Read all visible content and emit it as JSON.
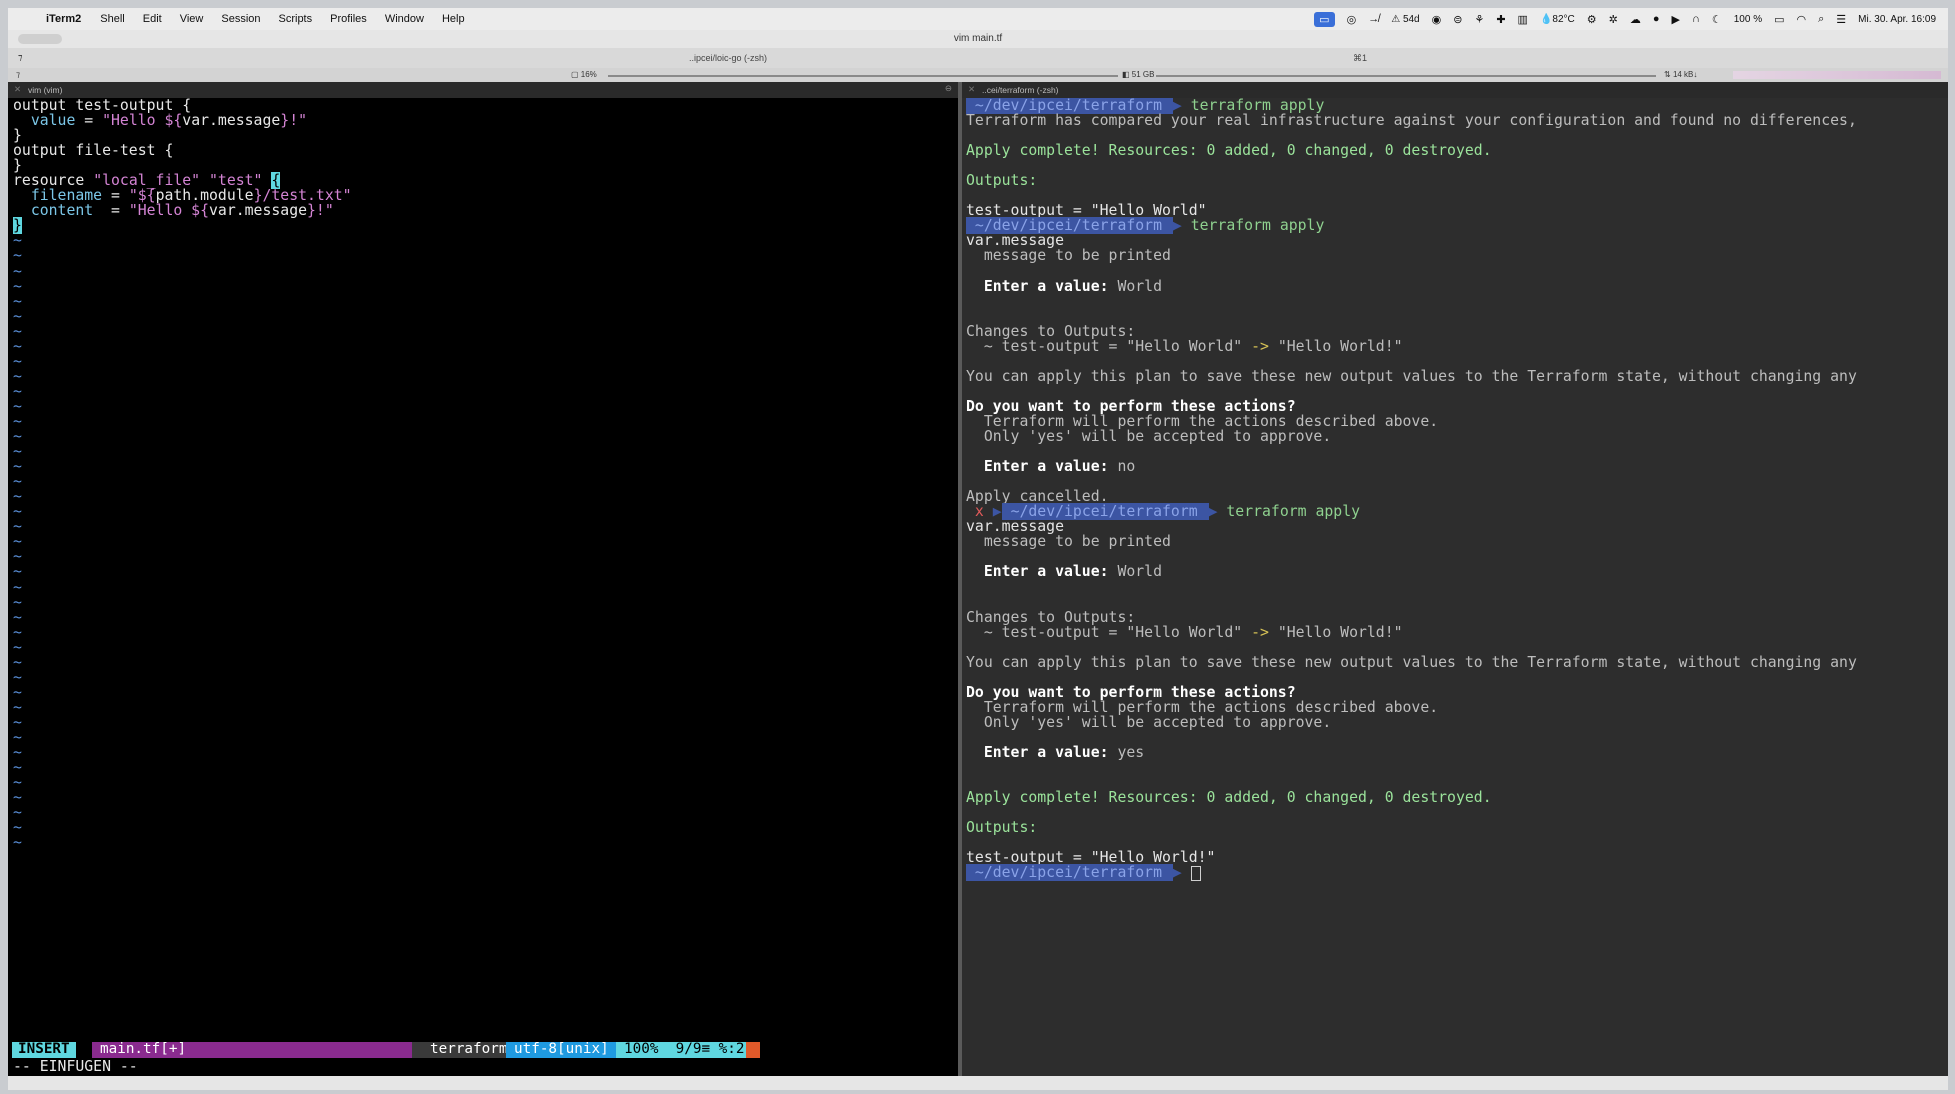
{
  "menubar": {
    "app_name": "iTerm2",
    "items": [
      "Shell",
      "Edit",
      "View",
      "Session",
      "Scripts",
      "Profiles",
      "Window",
      "Help"
    ],
    "status": {
      "net_up": "54d",
      "temp": "82°C",
      "battery": "100 %",
      "datetime": "Mi. 30. Apr. 16:09"
    }
  },
  "window": {
    "title": "vim main.tf",
    "tab_title": "..ipcei/loic-go (-zsh)",
    "tab_shortcut": "⌘1",
    "cpu": "16%",
    "memory": "51 GB",
    "network": "14 kB↓"
  },
  "left_pane": {
    "header": "vim (vim)",
    "code": [
      {
        "parts": [
          [
            "kw",
            "output test-output {"
          ]
        ]
      },
      {
        "parts": [
          [
            "attr",
            "  value"
          ],
          [
            "kw",
            " = "
          ],
          [
            "str",
            "\"Hello ${"
          ],
          [
            "kw",
            "var.message"
          ],
          [
            "str",
            "}!\""
          ]
        ]
      },
      {
        "parts": [
          [
            "kw",
            "}"
          ]
        ]
      },
      {
        "parts": [
          [
            "kw",
            "output file-test {"
          ]
        ]
      },
      {
        "parts": [
          [
            "kw",
            "}"
          ]
        ]
      },
      {
        "parts": [
          [
            "kw",
            "resource "
          ],
          [
            "str",
            "\"local_file\""
          ],
          [
            "kw",
            " "
          ],
          [
            "str",
            "\"test\""
          ],
          [
            "kw",
            " "
          ],
          [
            "cursor",
            "{"
          ]
        ]
      },
      {
        "parts": [
          [
            "attr",
            "  filename"
          ],
          [
            "kw",
            " = "
          ],
          [
            "str",
            "\"${"
          ],
          [
            "kw",
            "path.module"
          ],
          [
            "str",
            "}/test.txt\""
          ]
        ]
      },
      {
        "parts": [
          [
            "attr",
            "  content"
          ],
          [
            "kw",
            "  = "
          ],
          [
            "str",
            "\"Hello ${"
          ],
          [
            "kw",
            "var.message"
          ],
          [
            "str",
            "}!\""
          ]
        ]
      },
      {
        "parts": [
          [
            "cursor",
            "}"
          ]
        ]
      }
    ],
    "tilde_count": 41,
    "statusline": {
      "mode": "INSERT",
      "file": "main.tf[+]",
      "filetype": "terraform",
      "encoding": "utf-8[unix]",
      "position": "100%  9/9≡ %:2"
    },
    "command_line": "-- EINFUGEN --"
  },
  "right_pane": {
    "header": "..cei/terraform (-zsh)",
    "prompt_path": " ~/dev/ipcei/terraform ",
    "lines": [
      {
        "t": "prompt",
        "cmd": "terraform apply"
      },
      {
        "t": "dim",
        "s": "Terraform has compared your real infrastructure against your configuration and found no differences,"
      },
      {
        "t": "blank"
      },
      {
        "t": "green",
        "s": "Apply complete! Resources: 0 added, 0 changed, 0 destroyed."
      },
      {
        "t": "blank"
      },
      {
        "t": "green",
        "s": "Outputs:"
      },
      {
        "t": "blank"
      },
      {
        "t": "plain",
        "s": "test-output = \"Hello World\""
      },
      {
        "t": "prompt",
        "cmd": "terraform apply"
      },
      {
        "t": "plain",
        "s": "var.message"
      },
      {
        "t": "dim",
        "s": "  message to be printed"
      },
      {
        "t": "blank"
      },
      {
        "t": "enter",
        "label": "  Enter a value: ",
        "value": "World"
      },
      {
        "t": "blank"
      },
      {
        "t": "blank"
      },
      {
        "t": "dim",
        "s": "Changes to Outputs:"
      },
      {
        "t": "change",
        "pre": "  ~ test-output = \"Hello World\" ",
        "arrow": "->",
        "post": " \"Hello World!\""
      },
      {
        "t": "blank"
      },
      {
        "t": "dim",
        "s": "You can apply this plan to save these new output values to the Terraform state, without changing any"
      },
      {
        "t": "blank"
      },
      {
        "t": "bold",
        "s": "Do you want to perform these actions?"
      },
      {
        "t": "dim",
        "s": "  Terraform will perform the actions described above."
      },
      {
        "t": "dim",
        "s": "  Only 'yes' will be accepted to approve."
      },
      {
        "t": "blank"
      },
      {
        "t": "enter",
        "label": "  Enter a value: ",
        "value": "no"
      },
      {
        "t": "blank"
      },
      {
        "t": "dim",
        "s": "Apply cancelled."
      },
      {
        "t": "prompt_err",
        "cmd": "terraform apply"
      },
      {
        "t": "plain",
        "s": "var.message"
      },
      {
        "t": "dim",
        "s": "  message to be printed"
      },
      {
        "t": "blank"
      },
      {
        "t": "enter",
        "label": "  Enter a value: ",
        "value": "World"
      },
      {
        "t": "blank"
      },
      {
        "t": "blank"
      },
      {
        "t": "dim",
        "s": "Changes to Outputs:"
      },
      {
        "t": "change",
        "pre": "  ~ test-output = \"Hello World\" ",
        "arrow": "->",
        "post": " \"Hello World!\""
      },
      {
        "t": "blank"
      },
      {
        "t": "dim",
        "s": "You can apply this plan to save these new output values to the Terraform state, without changing any"
      },
      {
        "t": "blank"
      },
      {
        "t": "bold",
        "s": "Do you want to perform these actions?"
      },
      {
        "t": "dim",
        "s": "  Terraform will perform the actions described above."
      },
      {
        "t": "dim",
        "s": "  Only 'yes' will be accepted to approve."
      },
      {
        "t": "blank"
      },
      {
        "t": "enter",
        "label": "  Enter a value: ",
        "value": "yes"
      },
      {
        "t": "blank"
      },
      {
        "t": "blank"
      },
      {
        "t": "green",
        "s": "Apply complete! Resources: 0 added, 0 changed, 0 destroyed."
      },
      {
        "t": "blank"
      },
      {
        "t": "green",
        "s": "Outputs:"
      },
      {
        "t": "blank"
      },
      {
        "t": "plain",
        "s": "test-output = \"Hello World!\""
      },
      {
        "t": "prompt_cursor"
      }
    ]
  }
}
